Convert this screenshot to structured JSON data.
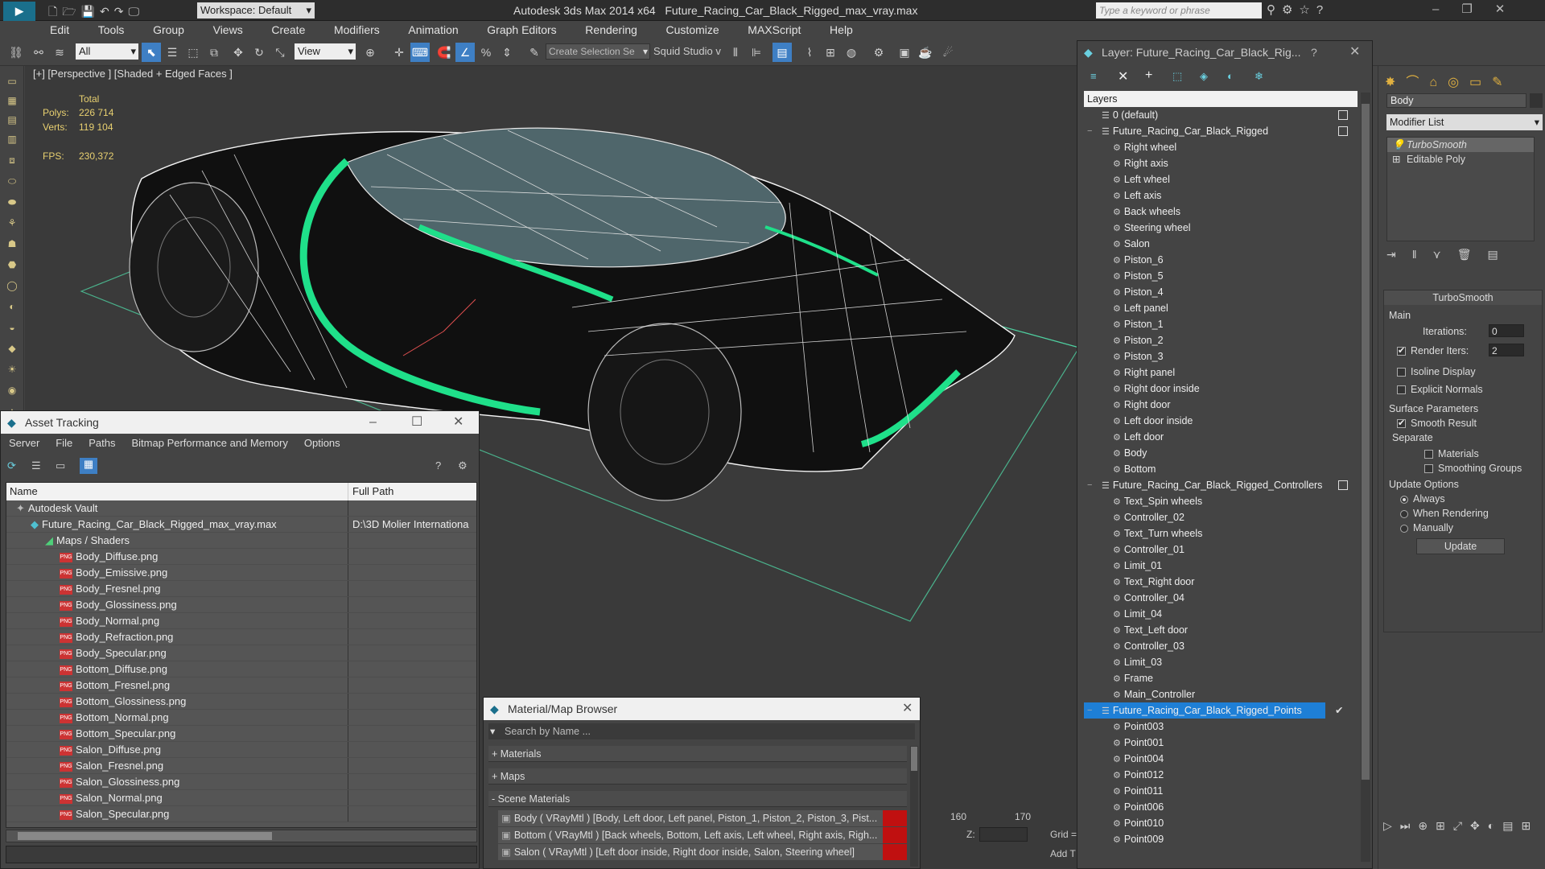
{
  "app": {
    "title": "Autodesk 3ds Max  2014 x64",
    "file": "Future_Racing_Car_Black_Rigged_max_vray.max",
    "workspace": "Workspace: Default",
    "search_placeholder": "Type a keyword or phrase"
  },
  "menu": [
    "Edit",
    "Tools",
    "Group",
    "Views",
    "Create",
    "Modifiers",
    "Animation",
    "Graph Editors",
    "Rendering",
    "Customize",
    "MAXScript",
    "Help"
  ],
  "toolbar": {
    "filter": "All",
    "view": "View",
    "selection_set": "Create Selection Se",
    "squid": "Squid Studio v"
  },
  "viewport": {
    "label": "[+] [Perspective ] [Shaded + Edged Faces ]",
    "stats": {
      "total_label": "Total",
      "polys_label": "Polys:",
      "polys": "226 714",
      "verts_label": "Verts:",
      "verts": "119 104",
      "fps_label": "FPS:",
      "fps": "230,372"
    },
    "timeline": [
      "160",
      "170"
    ],
    "z_label": "Z:",
    "grid_label": "Grid =",
    "add_label": "Add T"
  },
  "colors": {
    "accent": "#1fe08a",
    "selected": "#1e7fd6",
    "bg": "#444444",
    "viewport": "#3a3a3a"
  },
  "asset": {
    "title": "Asset Tracking",
    "menu": [
      "Server",
      "File",
      "Paths",
      "Bitmap Performance and Memory",
      "Options"
    ],
    "col_name": "Name",
    "col_path": "Full Path",
    "rows": [
      {
        "name": "Autodesk Vault",
        "path": "",
        "indent": 1,
        "icon": "vault"
      },
      {
        "name": "Future_Racing_Car_Black_Rigged_max_vray.max",
        "path": "D:\\3D Molier Internationa",
        "indent": 2,
        "icon": "max"
      },
      {
        "name": "Maps / Shaders",
        "path": "",
        "indent": 3,
        "icon": "maps"
      },
      {
        "name": "Body_Diffuse.png",
        "path": "",
        "indent": 4,
        "icon": "png"
      },
      {
        "name": "Body_Emissive.png",
        "path": "",
        "indent": 4,
        "icon": "png"
      },
      {
        "name": "Body_Fresnel.png",
        "path": "",
        "indent": 4,
        "icon": "png"
      },
      {
        "name": "Body_Glossiness.png",
        "path": "",
        "indent": 4,
        "icon": "png"
      },
      {
        "name": "Body_Normal.png",
        "path": "",
        "indent": 4,
        "icon": "png"
      },
      {
        "name": "Body_Refraction.png",
        "path": "",
        "indent": 4,
        "icon": "png"
      },
      {
        "name": "Body_Specular.png",
        "path": "",
        "indent": 4,
        "icon": "png"
      },
      {
        "name": "Bottom_Diffuse.png",
        "path": "",
        "indent": 4,
        "icon": "png"
      },
      {
        "name": "Bottom_Fresnel.png",
        "path": "",
        "indent": 4,
        "icon": "png"
      },
      {
        "name": "Bottom_Glossiness.png",
        "path": "",
        "indent": 4,
        "icon": "png"
      },
      {
        "name": "Bottom_Normal.png",
        "path": "",
        "indent": 4,
        "icon": "png"
      },
      {
        "name": "Bottom_Specular.png",
        "path": "",
        "indent": 4,
        "icon": "png"
      },
      {
        "name": "Salon_Diffuse.png",
        "path": "",
        "indent": 4,
        "icon": "png"
      },
      {
        "name": "Salon_Fresnel.png",
        "path": "",
        "indent": 4,
        "icon": "png"
      },
      {
        "name": "Salon_Glossiness.png",
        "path": "",
        "indent": 4,
        "icon": "png"
      },
      {
        "name": "Salon_Normal.png",
        "path": "",
        "indent": 4,
        "icon": "png"
      },
      {
        "name": "Salon_Specular.png",
        "path": "",
        "indent": 4,
        "icon": "png"
      }
    ]
  },
  "matbrowser": {
    "title": "Material/Map Browser",
    "search_placeholder": "Search by Name ...",
    "sections": [
      "+ Materials",
      "+ Maps",
      "- Scene Materials"
    ],
    "materials": [
      "Body  ( VRayMtl ) [Body, Left door, Left panel, Piston_1, Piston_2, Piston_3, Pist...",
      "Bottom  ( VRayMtl ) [Back wheels, Bottom, Left axis, Left wheel, Right axis, Righ...",
      "Salon  ( VRayMtl ) [Left door inside, Right door inside, Salon, Steering wheel]"
    ]
  },
  "layers": {
    "title": "Layer: Future_Racing_Car_Black_Rig...",
    "help": "?",
    "header": "Layers",
    "rows": [
      {
        "name": "0 (default)",
        "level": 0,
        "check": true
      },
      {
        "name": "Future_Racing_Car_Black_Rigged",
        "level": 0,
        "check": true,
        "expand": "−"
      },
      {
        "name": "Right wheel",
        "level": 1
      },
      {
        "name": "Right axis",
        "level": 1
      },
      {
        "name": "Left wheel",
        "level": 1
      },
      {
        "name": "Left axis",
        "level": 1
      },
      {
        "name": "Back wheels",
        "level": 1
      },
      {
        "name": "Steering wheel",
        "level": 1
      },
      {
        "name": "Salon",
        "level": 1
      },
      {
        "name": "Piston_6",
        "level": 1
      },
      {
        "name": "Piston_5",
        "level": 1
      },
      {
        "name": "Piston_4",
        "level": 1
      },
      {
        "name": "Left panel",
        "level": 1
      },
      {
        "name": "Piston_1",
        "level": 1
      },
      {
        "name": "Piston_2",
        "level": 1
      },
      {
        "name": "Piston_3",
        "level": 1
      },
      {
        "name": "Right panel",
        "level": 1
      },
      {
        "name": "Right door inside",
        "level": 1
      },
      {
        "name": "Right door",
        "level": 1
      },
      {
        "name": "Left door inside",
        "level": 1
      },
      {
        "name": "Left door",
        "level": 1
      },
      {
        "name": "Body",
        "level": 1
      },
      {
        "name": "Bottom",
        "level": 1
      },
      {
        "name": "Future_Racing_Car_Black_Rigged_Controllers",
        "level": 0,
        "check": true,
        "expand": "−"
      },
      {
        "name": "Text_Spin wheels",
        "level": 1
      },
      {
        "name": "Controller_02",
        "level": 1
      },
      {
        "name": "Text_Turn wheels",
        "level": 1
      },
      {
        "name": "Controller_01",
        "level": 1
      },
      {
        "name": "Limit_01",
        "level": 1
      },
      {
        "name": "Text_Right door",
        "level": 1
      },
      {
        "name": "Controller_04",
        "level": 1
      },
      {
        "name": "Limit_04",
        "level": 1
      },
      {
        "name": "Text_Left door",
        "level": 1
      },
      {
        "name": "Controller_03",
        "level": 1
      },
      {
        "name": "Limit_03",
        "level": 1
      },
      {
        "name": "Frame",
        "level": 1
      },
      {
        "name": "Main_Controller",
        "level": 1
      },
      {
        "name": "Future_Racing_Car_Black_Rigged_Points",
        "level": 0,
        "selected": true,
        "expand": "−",
        "tick": "✔"
      },
      {
        "name": "Point003",
        "level": 1
      },
      {
        "name": "Point001",
        "level": 1
      },
      {
        "name": "Point004",
        "level": 1
      },
      {
        "name": "Point012",
        "level": 1
      },
      {
        "name": "Point011",
        "level": 1
      },
      {
        "name": "Point006",
        "level": 1
      },
      {
        "name": "Point010",
        "level": 1
      },
      {
        "name": "Point009",
        "level": 1
      }
    ]
  },
  "cmd": {
    "object_name": "Body",
    "modifier_list": "Modifier List",
    "stack": [
      "TurboSmooth",
      "Editable Poly"
    ],
    "rollout": "TurboSmooth",
    "main": "Main",
    "iterations_label": "Iterations:",
    "iterations": "0",
    "render_iters_label": "Render Iters:",
    "render_iters": "2",
    "isoline": "Isoline Display",
    "explicit": "Explicit Normals",
    "surface": "Surface Parameters",
    "smooth": "Smooth Result",
    "separate": "Separate",
    "materials": "Materials",
    "smoothing": "Smoothing Groups",
    "update_opts": "Update Options",
    "always": "Always",
    "when_rendering": "When Rendering",
    "manually": "Manually",
    "update_btn": "Update"
  }
}
